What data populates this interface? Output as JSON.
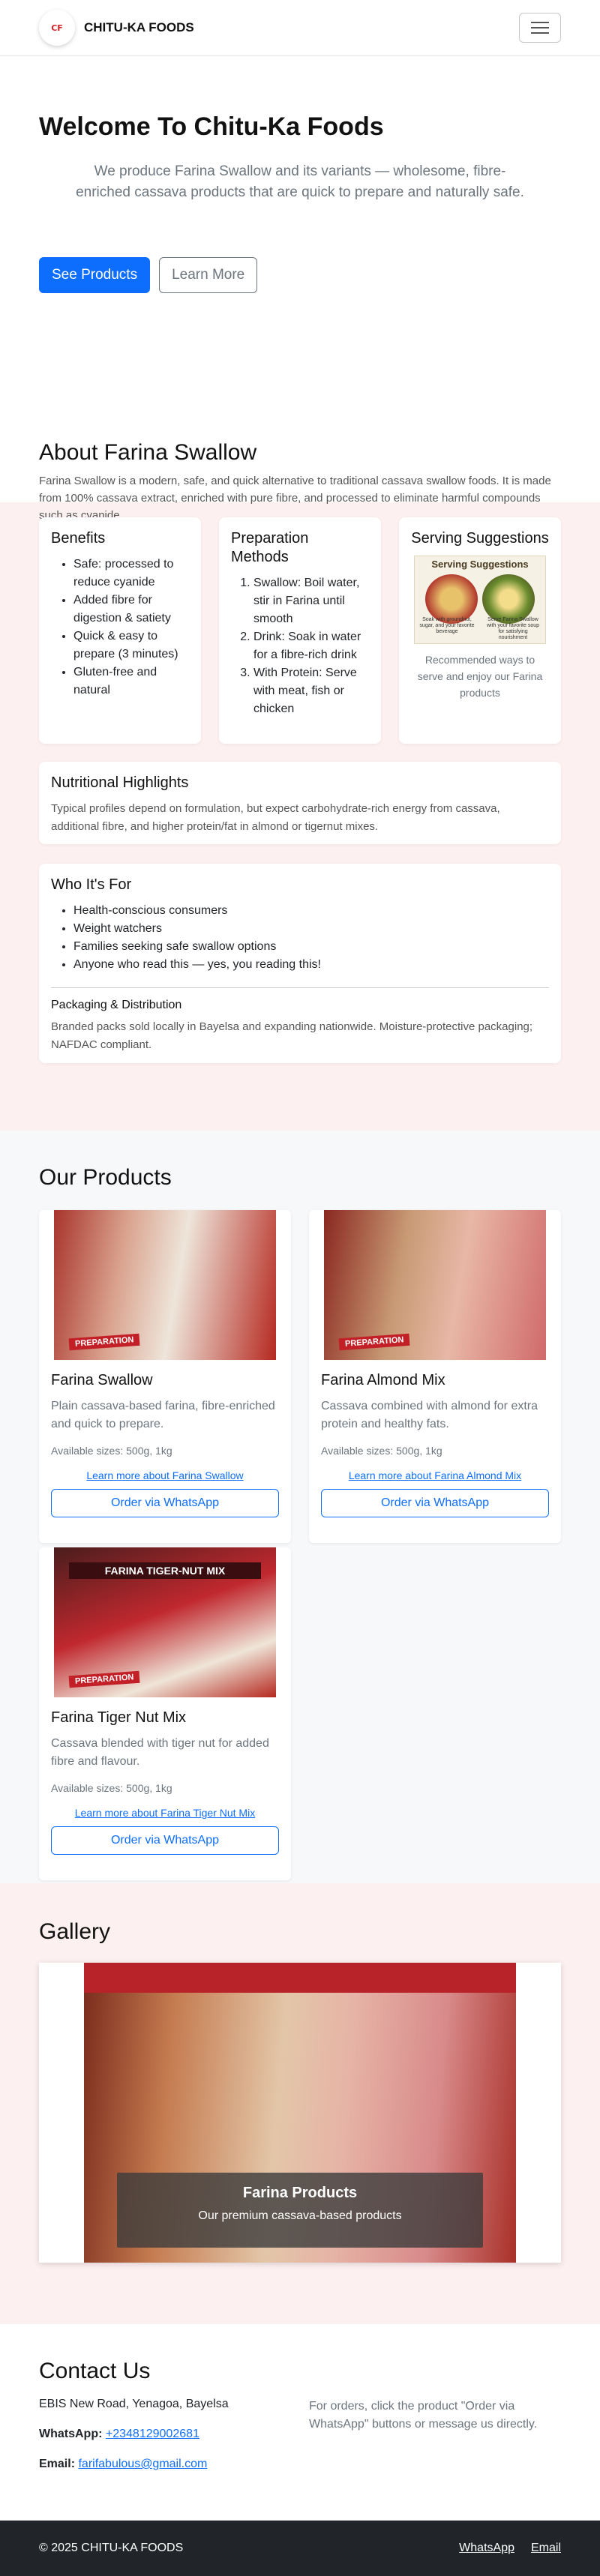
{
  "nav": {
    "logo_text": "CF",
    "brand": "CHITU-KA FOODS"
  },
  "hero": {
    "title": "Welcome To Chitu-Ka Foods",
    "subtitle": "We produce Farina Swallow and its variants — wholesome, fibre-enriched cassava products that are quick to prepare and naturally safe.",
    "primary_button": "See Products",
    "secondary_button": "Learn More"
  },
  "about": {
    "title": "About Farina Swallow",
    "intro": "Farina Swallow is a modern, safe, and quick alternative to traditional cassava swallow foods. It is made from 100% cassava extract, enriched with pure fibre, and processed to eliminate harmful compounds such as cyanide.",
    "benefits": {
      "title": "Benefits",
      "items": [
        "Safe: processed to reduce cyanide",
        "Added fibre for digestion & satiety",
        "Quick & easy to prepare (3 minutes)",
        "Gluten-free and natural"
      ]
    },
    "preparation": {
      "title": "Preparation Methods",
      "items": [
        "Swallow: Boil water, stir in Farina until smooth",
        "Drink: Soak in water for a fibre-rich drink",
        "With Protein: Serve with meat, fish or chicken"
      ]
    },
    "serving": {
      "title": "Serving Suggestions",
      "image_title": "Serving Suggestions",
      "image_caption_left": "Soak with groundnut, sugar, and your favorite beverage",
      "image_caption_right": "Serve Farina Swallow with your favorite soup for satisfying nourishment",
      "caption": "Recommended ways to serve and enjoy our Farina products"
    },
    "nutrition": {
      "title": "Nutritional Highlights",
      "text": "Typical profiles depend on formulation, but expect carbohydrate-rich energy from cassava, additional fibre, and higher protein/fat in almond or tigernut mixes."
    },
    "audience": {
      "title": "Who It's For",
      "items": [
        "Health-conscious consumers",
        "Weight watchers",
        "Families seeking safe swallow options",
        "Anyone who read this — yes, you reading this!"
      ],
      "packaging_title": "Packaging & Distribution",
      "packaging_text": "Branded packs sold locally in Bayelsa and expanding nationwide. Moisture-protective packaging; NAFDAC compliant."
    }
  },
  "products": {
    "title": "Our Products",
    "items": [
      {
        "name": "Farina Swallow",
        "description": "Plain cassava-based farina, fibre-enriched and quick to prepare.",
        "sizes": "Available sizes: 500g, 1kg",
        "link": "Learn more about Farina Swallow",
        "button": "Order via WhatsApp",
        "pack_label": "PREPARATION"
      },
      {
        "name": "Farina Almond Mix",
        "description": "Cassava combined with almond for extra protein and healthy fats.",
        "sizes": "Available sizes: 500g, 1kg",
        "link": "Learn more about Farina Almond Mix",
        "button": "Order via WhatsApp",
        "pack_label": "PREPARATION"
      },
      {
        "name": "Farina Tiger Nut Mix",
        "description": "Cassava blended with tiger nut for added fibre and flavour.",
        "sizes": "Available sizes: 500g, 1kg",
        "link": "Learn more about Farina Tiger Nut Mix",
        "button": "Order via WhatsApp",
        "pack_label": "PREPARATION",
        "pack_banner": "FARINA TIGER-NUT MIX"
      }
    ]
  },
  "gallery": {
    "title": "Gallery",
    "slide_title": "Farina Products",
    "slide_text": "Our premium cassava-based products"
  },
  "contact": {
    "title": "Contact Us",
    "address": "EBIS New Road, Yenagoa, Bayelsa",
    "whatsapp_label": "WhatsApp:",
    "whatsapp_value": "+2348129002681",
    "email_label": "Email:",
    "email_value": "farifabulous@gmail.com",
    "note": "For orders, click the product \"Order via WhatsApp\" buttons or message us directly."
  },
  "footer": {
    "copyright": "© 2025 CHITU-KA FOODS",
    "links": [
      "WhatsApp",
      "Email"
    ]
  },
  "colors": {
    "primary": "#0d6efd",
    "about_bg": "#fdf0f0",
    "products_bg": "#f7f8fa",
    "footer_bg": "#212529"
  }
}
